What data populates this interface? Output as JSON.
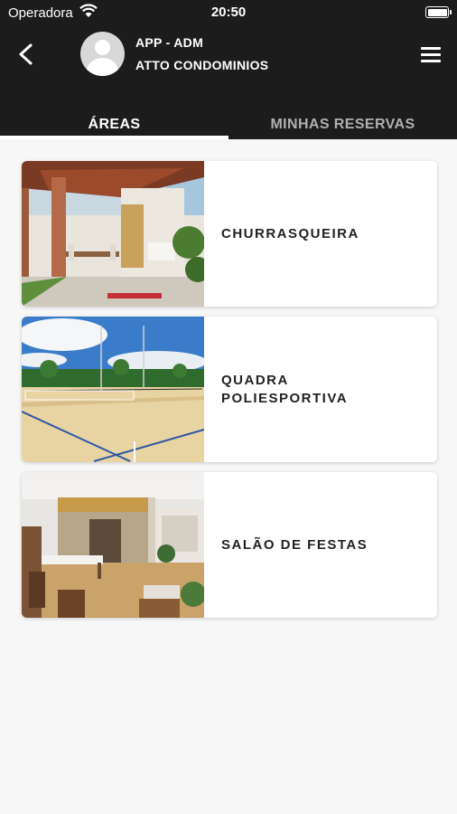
{
  "status_bar": {
    "carrier": "Operadora",
    "time": "20:50"
  },
  "header": {
    "user_name": "APP - ADM",
    "user_subtitle": "ATTO CONDOMINIOS",
    "icons": {
      "back": "chevron-left-icon",
      "menu": "hamburger-menu-icon",
      "avatar": "user-avatar-icon"
    }
  },
  "tabs": [
    {
      "label": "ÁREAS",
      "active": true
    },
    {
      "label": "MINHAS RESERVAS",
      "active": false
    }
  ],
  "areas": [
    {
      "label": "CHURRASQUEIRA",
      "image": "barbecue-area-photo"
    },
    {
      "label": "QUADRA POLIESPORTIVA",
      "image": "sports-court-photo"
    },
    {
      "label": "SALÃO DE FESTAS",
      "image": "party-hall-photo"
    }
  ],
  "colors": {
    "header_bg": "#1c1c1c",
    "background": "#f7f7f7",
    "tab_inactive": "#b0b0b0"
  }
}
